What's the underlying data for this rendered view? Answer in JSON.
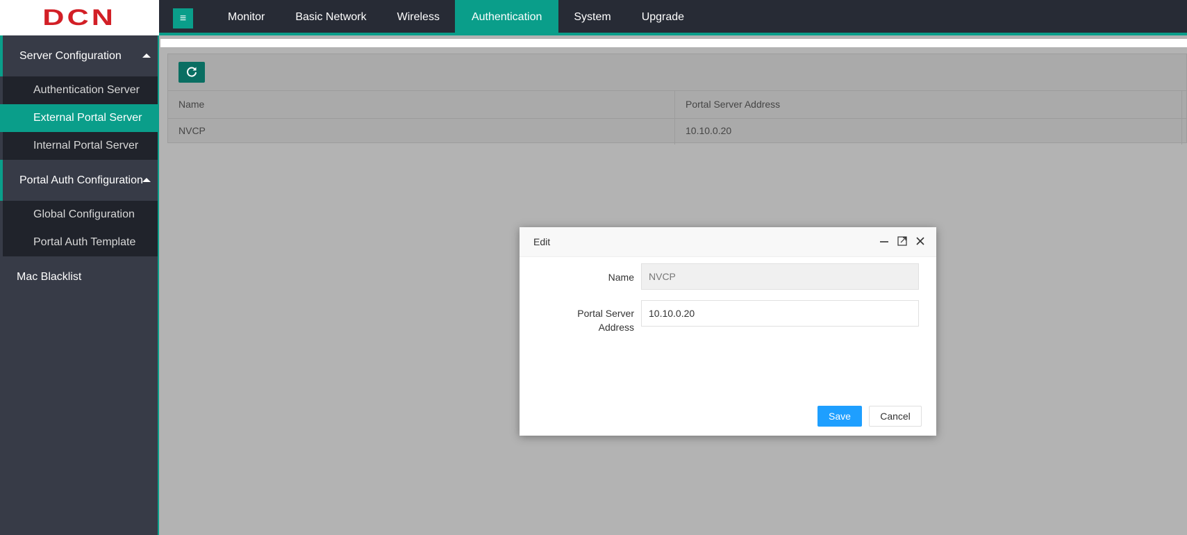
{
  "brand": {
    "logo_text": "DCN",
    "logo_color": "#d21f26"
  },
  "colors": {
    "accent": "#0a9e8a",
    "topbar_bg": "#272b35",
    "sidebar_bg": "#373b47",
    "primary_button": "#1e9fff"
  },
  "topbar": {
    "menu_icon": "hamburger-icon",
    "nav": [
      {
        "label": "Monitor"
      },
      {
        "label": "Basic Network"
      },
      {
        "label": "Wireless"
      },
      {
        "label": "Authentication",
        "active": true
      },
      {
        "label": "System"
      },
      {
        "label": "Upgrade"
      }
    ]
  },
  "sidebar": {
    "groups": [
      {
        "label": "Server Configuration",
        "expanded": true,
        "items": [
          {
            "label": "Authentication Server"
          },
          {
            "label": "External Portal Server",
            "active": true
          },
          {
            "label": "Internal Portal Server"
          }
        ]
      },
      {
        "label": "Portal Auth Configuration",
        "expanded": true,
        "items": [
          {
            "label": "Global Configuration"
          },
          {
            "label": "Portal Auth Template"
          }
        ]
      }
    ],
    "plain_items": [
      {
        "label": "Mac Blacklist"
      }
    ]
  },
  "table": {
    "toolbar_icon": "refresh-icon",
    "columns": [
      "Name",
      "Portal Server Address"
    ],
    "rows": [
      [
        "NVCP",
        "10.10.0.20"
      ]
    ]
  },
  "modal": {
    "title": "Edit",
    "tool_icons": [
      "minimize-icon",
      "maximize-icon",
      "close-icon"
    ],
    "fields": {
      "name": {
        "label": "Name",
        "value": "NVCP",
        "disabled": true
      },
      "address": {
        "label_line1": "Portal Server",
        "label_line2": "Address",
        "value": "10.10.0.20"
      }
    },
    "save_label": "Save",
    "cancel_label": "Cancel"
  }
}
